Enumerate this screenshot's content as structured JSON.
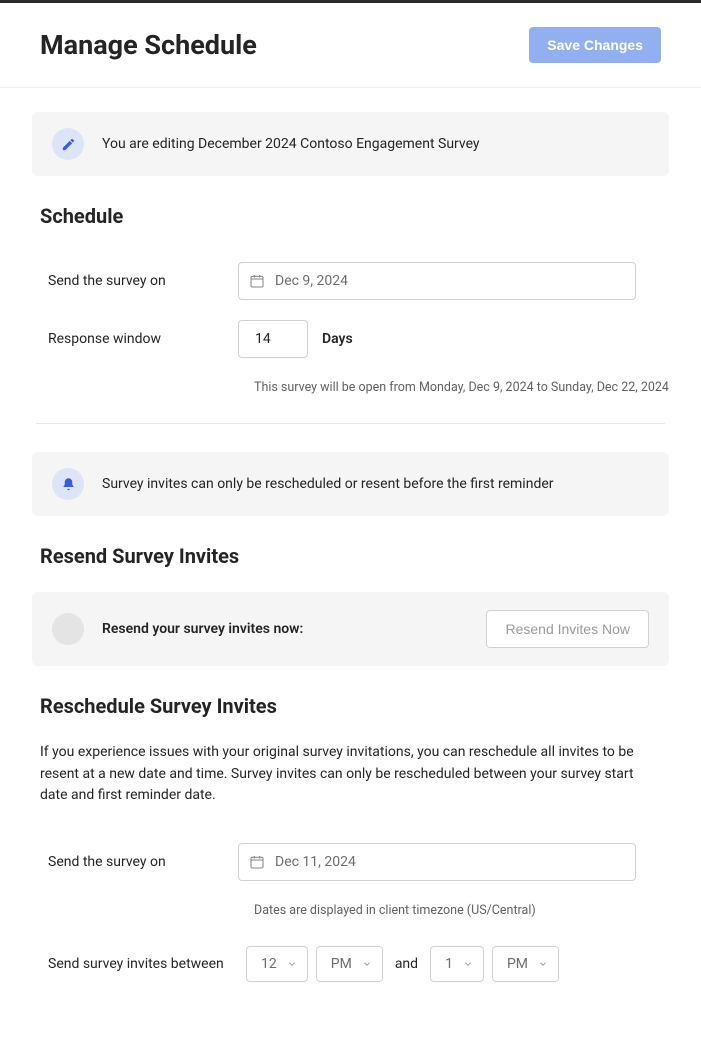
{
  "header": {
    "title": "Manage Schedule",
    "save_label": "Save Changes"
  },
  "editing_banner": {
    "text": "You are editing December 2024 Contoso Engagement Survey"
  },
  "schedule": {
    "section_title": "Schedule",
    "send_label": "Send the survey on",
    "send_date": "Dec 9, 2024",
    "response_window_label": "Response window",
    "response_window_value": "14",
    "days_label": "Days",
    "range_text": "This survey will be open from Monday, Dec 9, 2024 to Sunday, Dec 22, 2024"
  },
  "reminder_banner": {
    "text": "Survey invites can only be rescheduled or resent before the first reminder"
  },
  "resend": {
    "section_title": "Resend Survey Invites",
    "prompt": "Resend your survey invites now:",
    "button_label": "Resend Invites Now"
  },
  "reschedule": {
    "section_title": "Reschedule Survey Invites",
    "description": "If you experience issues with your original survey invitations, you can reschedule all invites to be resent at a new date and time. Survey invites can only be rescheduled between your survey start date and first reminder date.",
    "send_label": "Send the survey on",
    "send_date": "Dec 11, 2024",
    "tz_note": "Dates are displayed in client timezone (US/Central)",
    "between_label": "Send survey invites between",
    "start_hour": "12",
    "start_ampm": "PM",
    "and_label": "and",
    "end_hour": "1",
    "end_ampm": "PM"
  }
}
